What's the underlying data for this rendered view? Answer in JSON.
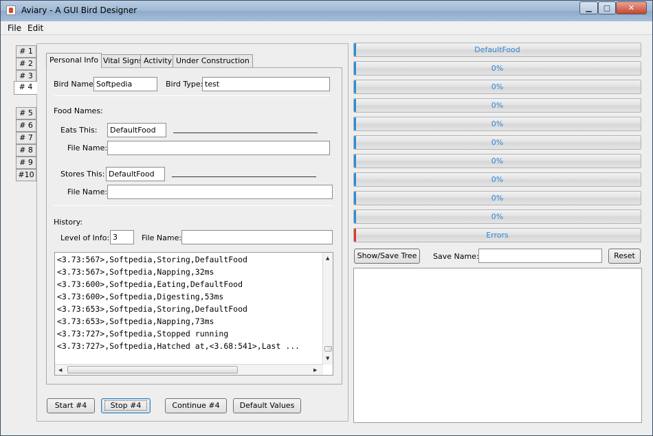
{
  "window": {
    "title": "Aviary - A GUI Bird Designer",
    "controls": [
      "minimize",
      "maximize",
      "close"
    ],
    "controls_glyphs": {
      "minimize": "▁",
      "maximize": "□",
      "close": "✕"
    }
  },
  "menu": {
    "items": [
      "File",
      "Edit"
    ]
  },
  "bird_tabs": {
    "items": [
      "# 1",
      "# 2",
      "# 3",
      "# 4",
      "# 5",
      "# 6",
      "# 7",
      "# 8",
      "# 9",
      "#10"
    ],
    "active": "# 4"
  },
  "info_tabs": {
    "items": [
      "Personal Info",
      "Vital Signs",
      "Activity",
      "Under Construction"
    ],
    "active": "Personal Info"
  },
  "personal_info": {
    "bird_name_label": "Bird Name:",
    "bird_name_value": "Softpedia",
    "bird_type_label": "Bird Type:",
    "bird_type_value": "test",
    "food_names_label": "Food Names:",
    "eats_label": "Eats  This:",
    "eats_value": "DefaultFood",
    "eats_file_label": "File Name:",
    "eats_file_value": "",
    "stores_label": "Stores This:",
    "stores_value": "DefaultFood",
    "stores_file_label": "File Name:",
    "stores_file_value": "",
    "history_label": "History:",
    "level_label": "Level of Info:",
    "level_value": "3",
    "history_file_label": "File Name:",
    "history_file_value": ""
  },
  "history_log": [
    "<3.73:567>,Softpedia,Storing,DefaultFood",
    "<3.73:567>,Softpedia,Napping,32ms",
    "<3.73:600>,Softpedia,Eating,DefaultFood",
    "<3.73:600>,Softpedia,Digesting,53ms",
    "<3.73:653>,Softpedia,Storing,DefaultFood",
    "<3.73:653>,Softpedia,Napping,73ms",
    "<3.73:727>,Softpedia,Stopped running",
    "<3.73:727>,Softpedia,Hatched at,<3.68:541>,Last ..."
  ],
  "actions": {
    "start": "Start #4",
    "stop": "Stop  #4",
    "continue": "Continue #4",
    "defaults": "Default Values"
  },
  "progress_bars": [
    {
      "label": "DefaultFood",
      "value": 0
    },
    {
      "label": "0%",
      "value": 0
    },
    {
      "label": "0%",
      "value": 0
    },
    {
      "label": "0%",
      "value": 0
    },
    {
      "label": "0%",
      "value": 0
    },
    {
      "label": "0%",
      "value": 0
    },
    {
      "label": "0%",
      "value": 0
    },
    {
      "label": "0%",
      "value": 0
    },
    {
      "label": "0%",
      "value": 0
    },
    {
      "label": "0%",
      "value": 0
    },
    {
      "label": "Errors",
      "value": 0
    }
  ],
  "tree_controls": {
    "show_save_label": "Show/Save Tree",
    "save_name_label": "Save Name:",
    "save_name_value": "",
    "reset_label": "Reset"
  },
  "colors": {
    "progress_text": "#2f86d4",
    "progress_fill": "#2a8dd8",
    "error_fill": "#d93a2a"
  }
}
